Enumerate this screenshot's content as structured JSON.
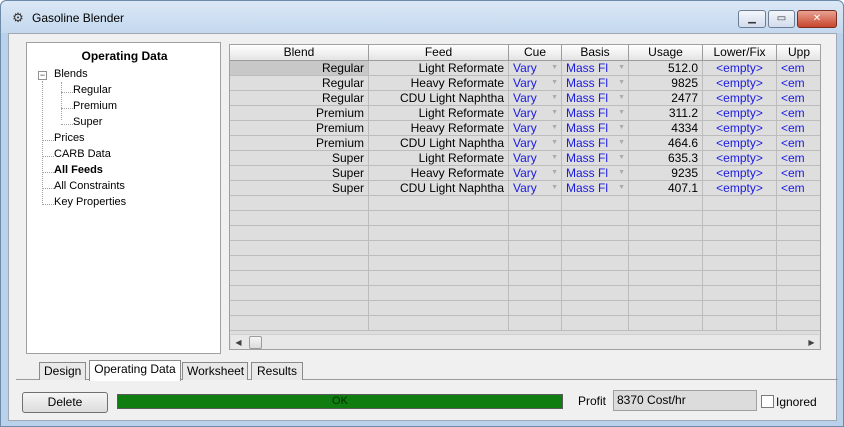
{
  "window": {
    "title": "Gasoline Blender"
  },
  "tree": {
    "title": "Operating Data",
    "items": [
      {
        "label": "Blends",
        "bold": false
      },
      {
        "label": "Regular",
        "bold": false
      },
      {
        "label": "Premium",
        "bold": false
      },
      {
        "label": "Super",
        "bold": false
      },
      {
        "label": "Prices",
        "bold": false
      },
      {
        "label": "CARB Data",
        "bold": false
      },
      {
        "label": "All Feeds",
        "bold": true
      },
      {
        "label": "All Constraints",
        "bold": false
      },
      {
        "label": "Key Properties",
        "bold": false
      }
    ]
  },
  "grid": {
    "columns": [
      "Blend",
      "Feed",
      "Cue",
      "Basis",
      "Usage",
      "Lower/Fix",
      "Upp"
    ],
    "rows": [
      [
        "Regular",
        "Light Reformate",
        "Vary",
        "Mass Fl",
        "512.0",
        "<empty>",
        "<em"
      ],
      [
        "Regular",
        "Heavy Reformate",
        "Vary",
        "Mass Fl",
        "9825",
        "<empty>",
        "<em"
      ],
      [
        "Regular",
        "CDU Light Naphtha",
        "Vary",
        "Mass Fl",
        "2477",
        "<empty>",
        "<em"
      ],
      [
        "Premium",
        "Light Reformate",
        "Vary",
        "Mass Fl",
        "311.2",
        "<empty>",
        "<em"
      ],
      [
        "Premium",
        "Heavy Reformate",
        "Vary",
        "Mass Fl",
        "4334",
        "<empty>",
        "<em"
      ],
      [
        "Premium",
        "CDU Light Naphtha",
        "Vary",
        "Mass Fl",
        "464.6",
        "<empty>",
        "<em"
      ],
      [
        "Super",
        "Light Reformate",
        "Vary",
        "Mass Fl",
        "635.3",
        "<empty>",
        "<em"
      ],
      [
        "Super",
        "Heavy Reformate",
        "Vary",
        "Mass Fl",
        "9235",
        "<empty>",
        "<em"
      ],
      [
        "Super",
        "CDU Light Naphtha",
        "Vary",
        "Mass Fl",
        "407.1",
        "<empty>",
        "<em"
      ]
    ]
  },
  "tabs": [
    "Design",
    "Operating Data",
    "Worksheet",
    "Results"
  ],
  "footer": {
    "delete_label": "Delete",
    "status_text": "OK",
    "profit_label": "Profit",
    "profit_value": "8370 Cost/hr",
    "ignored_label": "Ignored"
  },
  "colors": {
    "status": "#0f7d0f",
    "link_blue": "#1a1ae0"
  }
}
